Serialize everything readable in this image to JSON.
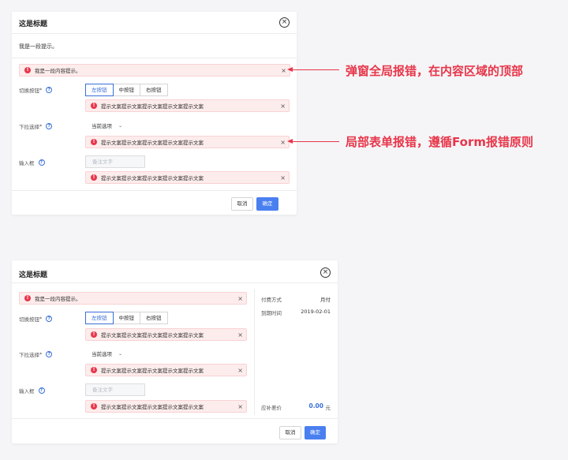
{
  "dialog1": {
    "title": "这是标题",
    "hint": "我是一段提示。",
    "global_error": "我是一段内容提示。",
    "fields": [
      {
        "label": "切换按钮",
        "required_mark": "*",
        "buttons": [
          "左按钮",
          "中按钮",
          "右按钮"
        ],
        "error": "提示文案提示文案提示文案提示文案提示文案"
      },
      {
        "label": "下拉选择",
        "required_mark": "*",
        "select_value": "当前选项",
        "error": "提示文案提示文案提示文案提示文案提示文案"
      },
      {
        "label": "输入框",
        "placeholder": "备注文字",
        "error": "提示文案提示文案提示文案提示文案提示文案"
      }
    ],
    "cancel_label": "取消",
    "confirm_label": "确定"
  },
  "dialog2": {
    "title": "这是标题",
    "global_error": "我是一段内容提示。",
    "fields": [
      {
        "label": "切换按钮",
        "required_mark": "*",
        "buttons": [
          "左按钮",
          "中按钮",
          "右按钮"
        ],
        "error": "提示文案提示文案提示文案提示文案提示文案"
      },
      {
        "label": "下拉选择",
        "required_mark": "*",
        "select_value": "当前选项",
        "error": "提示文案提示文案提示文案提示文案提示文案"
      },
      {
        "label": "输入框",
        "placeholder": "备注文字",
        "error": "提示文案提示文案提示文案提示文案提示文案"
      }
    ],
    "side": {
      "payment_label": "付费方式",
      "payment_value": "月付",
      "expiry_label": "到期时间",
      "expiry_value": "2019-02-01",
      "diff_label": "应补差价",
      "diff_value": "0.00",
      "diff_unit": "元"
    },
    "cancel_label": "取消",
    "confirm_label": "确定"
  },
  "annotations": {
    "global": "弹窗全局报错，在内容区域的顶部",
    "form": "局部表单报错，遵循Form报错原则"
  },
  "icons": {
    "close": "×",
    "error": "!",
    "help": "?",
    "chevron": "⌄",
    "dismiss": "×"
  },
  "colors": {
    "error_red": "#e8364a",
    "error_bg": "#fdecec",
    "primary": "#4a7ff0",
    "link_blue": "#3a6fd8"
  }
}
